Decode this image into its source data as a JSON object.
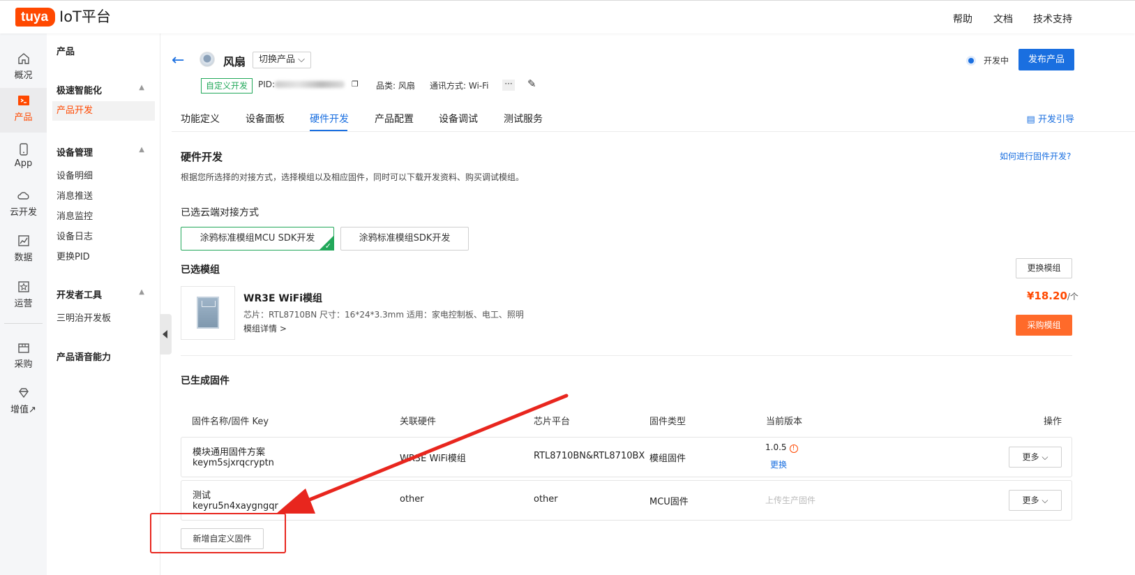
{
  "topbar": {
    "logo": "tuya",
    "title": "IoT平台",
    "nav": [
      "帮助",
      "文档",
      "技术支持"
    ]
  },
  "rail": {
    "items": [
      {
        "label": "概况",
        "icon": "home-icon"
      },
      {
        "label": "产品",
        "icon": "terminal-icon",
        "active": true
      },
      {
        "label": "App",
        "icon": "phone-icon"
      },
      {
        "label": "云开发",
        "icon": "cloud-icon"
      },
      {
        "label": "数据",
        "icon": "chart-icon"
      },
      {
        "label": "运营",
        "icon": "star-icon"
      },
      {
        "label": "采购",
        "icon": "box-icon"
      },
      {
        "label": "增值↗",
        "icon": "diamond-icon"
      }
    ]
  },
  "sidebar": {
    "title": "产品",
    "groups": [
      {
        "title": "极速智能化",
        "items": [
          "产品开发"
        ]
      },
      {
        "title": "设备管理",
        "items": [
          "设备明细",
          "消息推送",
          "消息监控",
          "设备日志",
          "更换PID"
        ]
      },
      {
        "title": "开发者工具",
        "items": [
          "三明治开发板"
        ]
      },
      {
        "title": "产品语音能力",
        "items": []
      }
    ]
  },
  "product": {
    "name": "风扇",
    "switch_label": "切换产品",
    "tag": "自定义开发",
    "pid_label": "PID:",
    "category": "品类: 风扇",
    "comm": "通讯方式: Wi-Fi",
    "more": "···",
    "status": "开发中",
    "publish": "发布产品"
  },
  "tabs": {
    "items": [
      "功能定义",
      "设备面板",
      "硬件开发",
      "产品配置",
      "设备调试",
      "测试服务"
    ],
    "active": "硬件开发",
    "guide": "开发引导"
  },
  "hardware": {
    "title": "硬件开发",
    "desc": "根据您所选择的对接方式，选择模组以及相应固件，同时可以下载开发资料、购买调试模组。",
    "help": "如何进行固件开发?",
    "cloud_title": "已选云端对接方式",
    "options": [
      "涂鸦标准模组MCU SDK开发",
      "涂鸦标准模组SDK开发"
    ],
    "module_title": "已选模组",
    "change_module": "更换模组",
    "module": {
      "name": "WR3E WiFi模组",
      "spec": "芯片：RTL8710BN    尺寸：16*24*3.3mm    适用：家电控制板、电工、照明",
      "detail": "模组详情 >",
      "price": "¥18.20",
      "unit": "/个",
      "buy": "采购模组"
    }
  },
  "firmware": {
    "title": "已生成固件",
    "headers": [
      "固件名称/固件 Key",
      "关联硬件",
      "芯片平台",
      "固件类型",
      "当前版本",
      "操作"
    ],
    "rows": [
      {
        "name": "模块通用固件方案",
        "key": "keym5sjxrqcryptn",
        "hardware": "WR3E WiFi模组",
        "chip": "RTL8710BN&RTL8710BX",
        "type": "模组固件",
        "version": "1.0.5",
        "version_action": "更换",
        "more": "更多"
      },
      {
        "name": "测试",
        "key": "keyru5n4xaygngqr",
        "hardware": "other",
        "chip": "other",
        "type": "MCU固件",
        "version": "上传生产固件",
        "more": "更多"
      }
    ],
    "add_button": "新增自定义固件"
  },
  "colors": {
    "brand": "#ff4800",
    "primary": "#1a6fe0",
    "success": "#22a85a",
    "annotation": "#e8261e"
  }
}
